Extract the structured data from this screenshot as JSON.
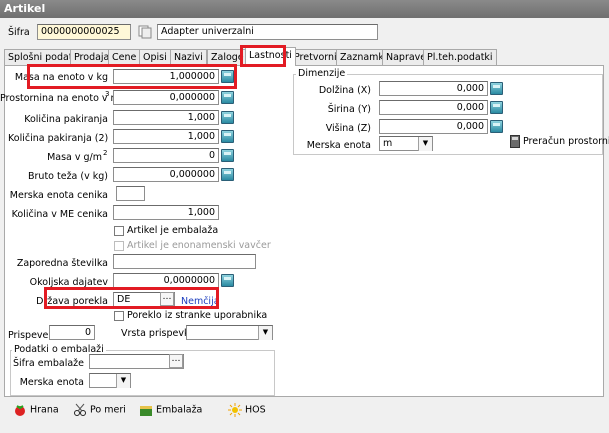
{
  "window": {
    "title": "Artikel"
  },
  "header": {
    "sifra_label": "Šifra",
    "sifra_value": "0000000000025",
    "name_value": "Adapter univerzalni"
  },
  "tabs": [
    {
      "label": "Splošni podatki"
    },
    {
      "label": "Prodaja"
    },
    {
      "label": "Cene"
    },
    {
      "label": "Opisi"
    },
    {
      "label": "Nazivi"
    },
    {
      "label": "Zaloge"
    },
    {
      "label": "Lastnosti",
      "active": true
    },
    {
      "label": "Pretvorniki"
    },
    {
      "label": "Zaznamki"
    },
    {
      "label": "Naprave"
    },
    {
      "label": "Pl.teh.podatki"
    }
  ],
  "fields": {
    "masa_label": "Masa na enoto v kg",
    "masa_value": "1,000000",
    "prostornina_label": "Prostornina na enoto v m",
    "prostornina_sup": "3",
    "prostornina_value": "0,000000",
    "kol_pak_label": "Količina pakiranja",
    "kol_pak_value": "1,000",
    "kol_pak2_label": "Količina pakiranja (2)",
    "kol_pak2_value": "1,000",
    "masa_gm_label": "Masa v g/m",
    "masa_gm_sup": "2",
    "masa_gm_value": "0",
    "bruto_label": "Bruto teža (v kg)",
    "bruto_value": "0,000000",
    "merska_cenika_label": "Merska enota cenika",
    "merska_cenika_value": "",
    "kol_me_label": "Količina v ME cenika",
    "kol_me_value": "1,000",
    "embalaza_chk_label": "Artikel je embalaža",
    "enonamenski_chk_label": "Artikel je enonamenski vavčer",
    "zaporedna_label": "Zaporedna številka",
    "zaporedna_value": "",
    "okoljska_label": "Okoljska dajatev",
    "okoljska_value": "0,0000000",
    "drzava_label": "Država porekla",
    "drzava_value": "DE",
    "drzava_name": "Nemčija",
    "poreklo_chk_label": "Poreklo iz stranke uporabnika",
    "prispevek_label": "Prispevek",
    "prispevek_value": "0",
    "vrsta_prispevka_label": "Vrsta prispevka",
    "vrsta_prispevka_value": ""
  },
  "embalaza_group": {
    "title": "Podatki o embalaži",
    "sifra_label": "Šifra embalaže",
    "sifra_value": "",
    "merska_label": "Merska enota",
    "merska_value": ""
  },
  "dimenzije": {
    "title": "Dimenzije",
    "dolzina_label": "Dolžina (X)",
    "dolzina_value": "0,000",
    "sirina_label": "Širina (Y)",
    "sirina_value": "0,000",
    "visina_label": "Višina (Z)",
    "visina_value": "0,000",
    "merska_label": "Merska enota",
    "merska_value": "m",
    "preracun_label": "Preračun prostornine"
  },
  "bottom_buttons": [
    {
      "label": "Hrana",
      "icon": "strawberry-icon"
    },
    {
      "label": "Po meri",
      "icon": "scissors-icon"
    },
    {
      "label": "Embalaža",
      "icon": "box-icon"
    },
    {
      "label": "HOS",
      "icon": "sun-icon"
    }
  ],
  "colors": {
    "highlight": "#e21b23",
    "link": "#1e3fbf",
    "input_yellow": "#fff8d8"
  }
}
